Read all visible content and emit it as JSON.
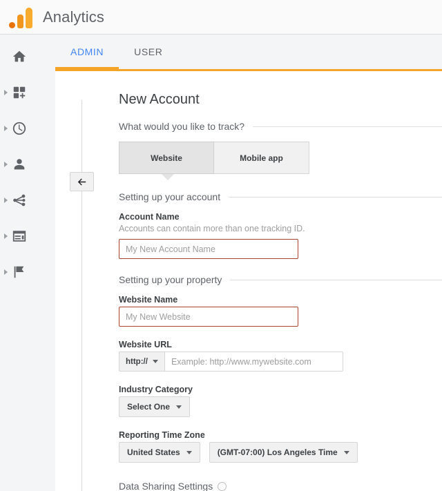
{
  "header": {
    "brand": "Analytics",
    "logo_icon": "analytics-logo-icon"
  },
  "sidebar": {
    "items": [
      {
        "label": "Home",
        "icon": "home-icon",
        "expandable": false
      },
      {
        "label": "Customization",
        "icon": "customization-grid-plus-icon",
        "expandable": true
      },
      {
        "label": "Realtime",
        "icon": "clock-icon",
        "expandable": true
      },
      {
        "label": "Audience",
        "icon": "person-icon",
        "expandable": true
      },
      {
        "label": "Acquisition",
        "icon": "share-branch-icon",
        "expandable": true
      },
      {
        "label": "Behavior",
        "icon": "page-card-icon",
        "expandable": true
      },
      {
        "label": "Conversions",
        "icon": "flag-icon",
        "expandable": true
      }
    ]
  },
  "tabs": [
    {
      "label": "ADMIN",
      "active": true
    },
    {
      "label": "USER",
      "active": false
    }
  ],
  "back_button": {
    "icon": "arrow-left-icon"
  },
  "main": {
    "page_title": "New Account",
    "track_question": "What would you like to track?",
    "track_options": [
      {
        "label": "Website",
        "selected": true
      },
      {
        "label": "Mobile app",
        "selected": false
      }
    ],
    "account_section": {
      "heading": "Setting up your account",
      "account_name_label": "Account Name",
      "account_name_hint": "Accounts can contain more than one tracking ID.",
      "account_name_value": "",
      "account_name_placeholder": "My New Account Name"
    },
    "property_section": {
      "heading": "Setting up your property",
      "website_name_label": "Website Name",
      "website_name_value": "",
      "website_name_placeholder": "My New Website",
      "website_url_label": "Website URL",
      "url_protocol": "http://",
      "website_url_value": "",
      "website_url_placeholder": "Example: http://www.mywebsite.com",
      "industry_label": "Industry Category",
      "industry_value": "Select One",
      "timezone_label": "Reporting Time Zone",
      "timezone_country": "United States",
      "timezone_value": "(GMT-07:00) Los Angeles Time"
    },
    "data_sharing": {
      "heading": "Data Sharing Settings",
      "info_icon": "info-icon"
    }
  },
  "colors": {
    "accent_orange": "#f4a428",
    "tab_active_blue": "#4285f4",
    "error_border": "#a8432e"
  }
}
